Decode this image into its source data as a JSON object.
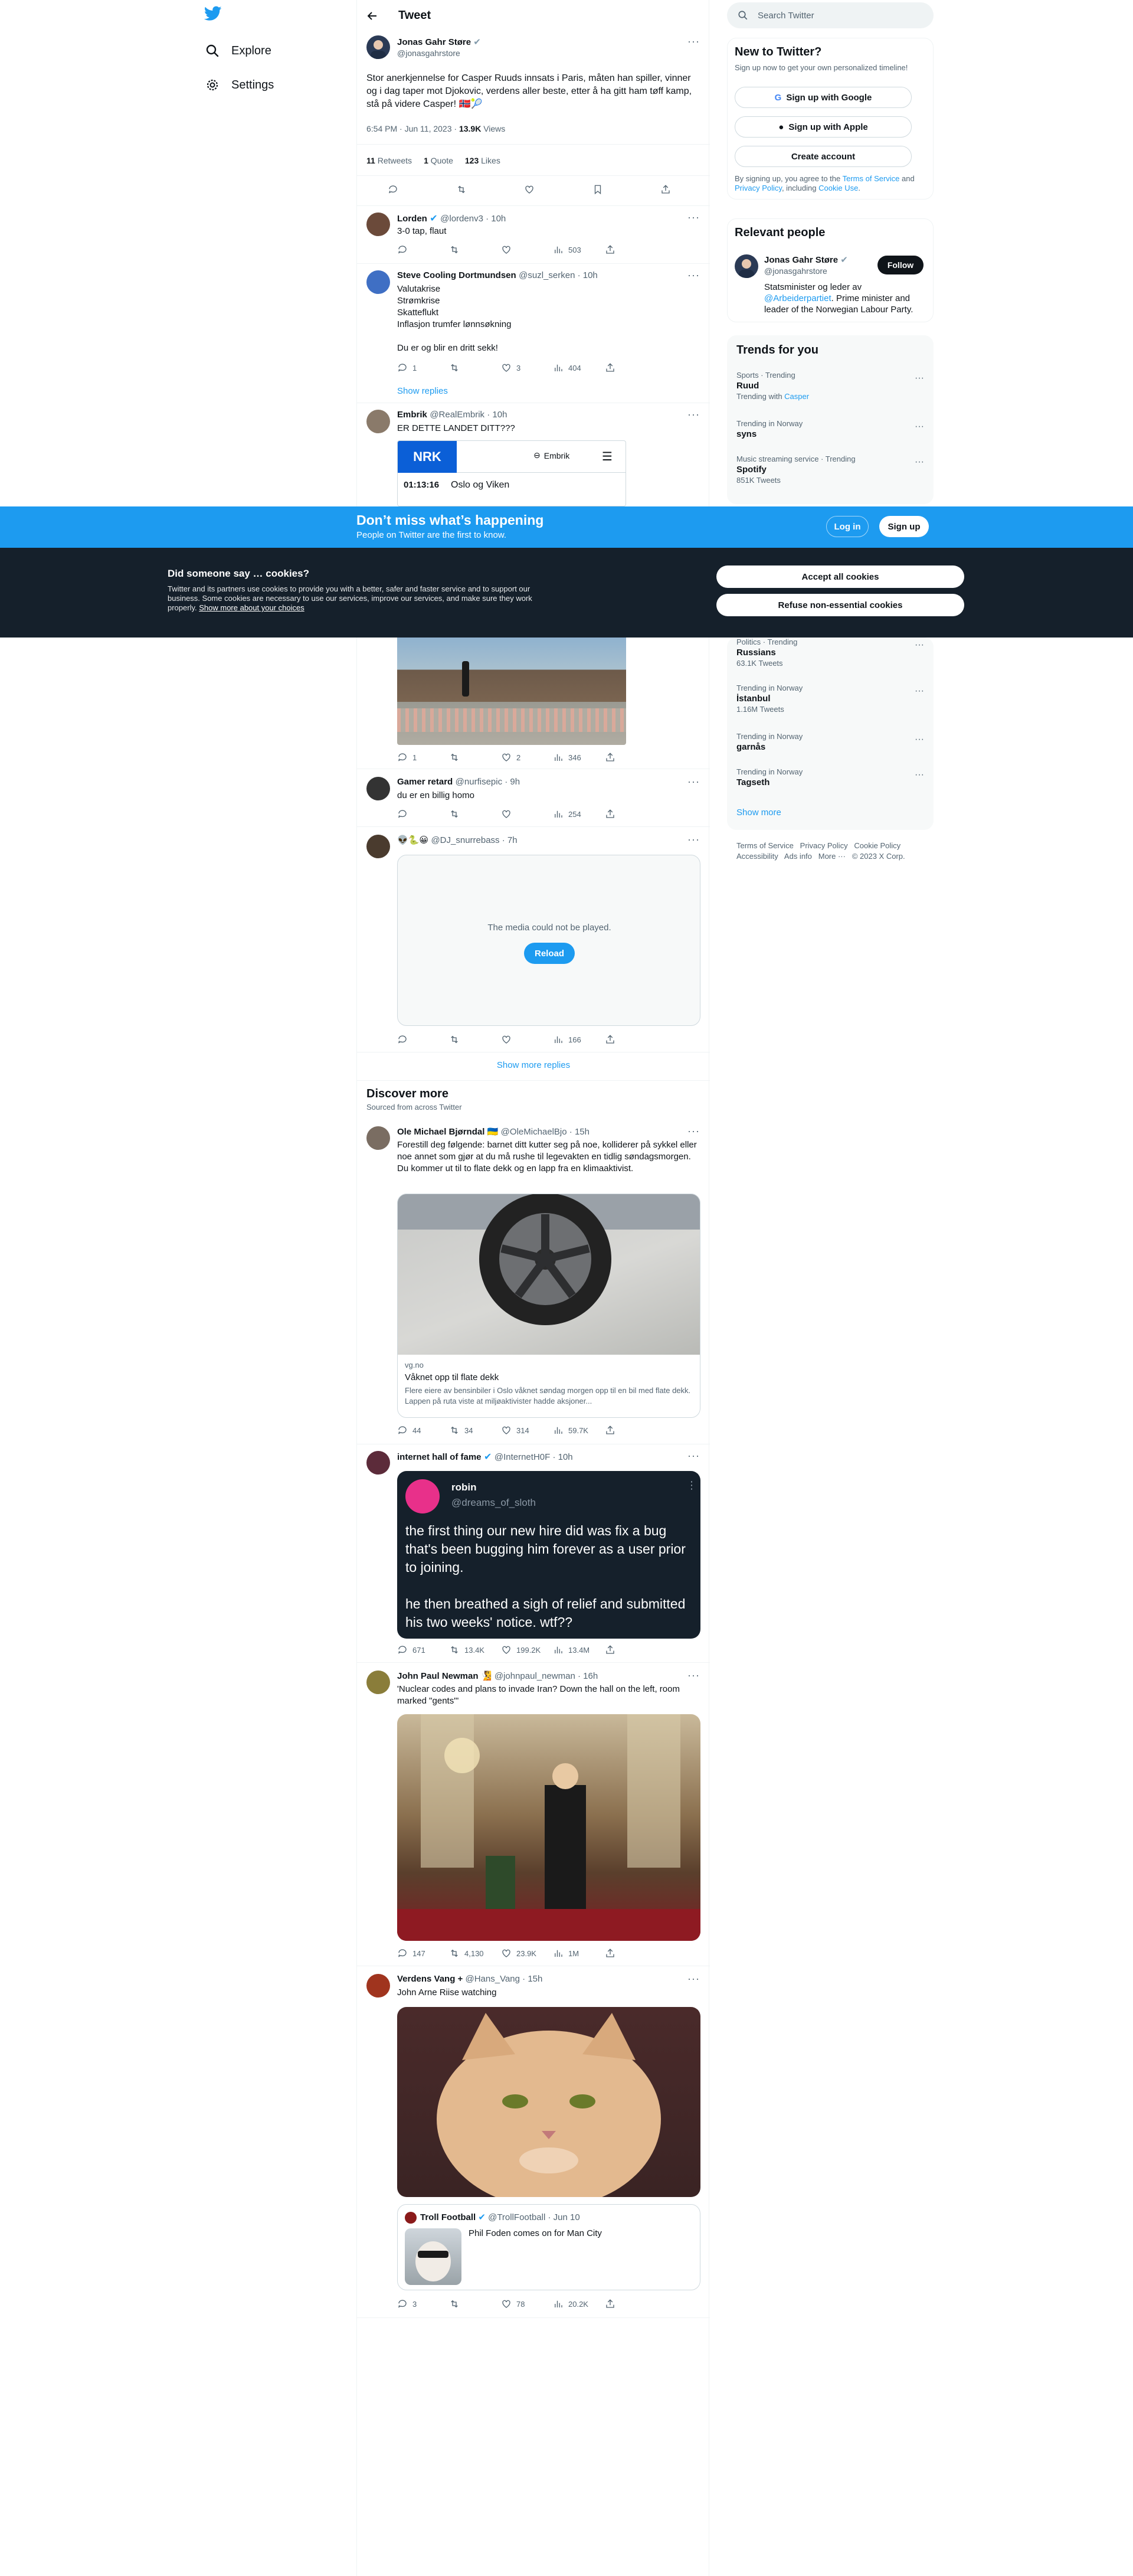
{
  "nav": {
    "explore": "Explore",
    "settings": "Settings"
  },
  "header": {
    "title": "Tweet"
  },
  "main_tweet": {
    "name": "Jonas Gahr Støre",
    "handle": "@jonasgahrstore",
    "text": "Stor anerkjennelse for Casper Ruuds innsats i Paris, måten han spiller, vinner og i dag taper mot Djokovic, verdens aller beste, etter å ha gitt ham tøff kamp, stå på videre Casper! 🇳🇴🎾",
    "time": "6:54 PM · Jun 11, 2023",
    "views_count": "13.9K",
    "views_label": "Views",
    "retweets_count": "11",
    "retweets_label": "Retweets",
    "quotes_count": "1",
    "quotes_label": "Quote",
    "likes_count": "123",
    "likes_label": "Likes"
  },
  "replies": [
    {
      "name": "Lorden",
      "handle": "@lordenv3 · 10h",
      "text": "3-0 tap, flaut",
      "replies": "",
      "retweets": "",
      "likes": "",
      "views": "503"
    },
    {
      "name": "Steve Cooling Dortmundsen",
      "handle": "@suzl_serken · 10h",
      "text": "Valutakrise\nStrømkrise\nSkatteflukt\nInflasjon trumfer lønnsøkning\n\nDu er og blir en dritt sekk!",
      "replies": "1",
      "retweets": "",
      "likes": "3",
      "views": "404",
      "show_replies": "Show replies"
    },
    {
      "name": "Embrik",
      "handle": "@RealEmbrik · 10h",
      "text": "ER DETTE LANDET DITT???",
      "replies": "1",
      "retweets": "",
      "likes": "2",
      "views": "346",
      "card_logo": "NRK",
      "card_user": "Embrik",
      "card_time": "01:13:16",
      "card_place": "Oslo og Viken"
    },
    {
      "name": "Gamer retard",
      "handle": "@nurfisepic · 9h",
      "text": "du er en billig homo",
      "replies": "",
      "retweets": "",
      "likes": "",
      "views": "254"
    },
    {
      "name": "👽🐍😀",
      "handle": "@DJ_snurrebass · 7h",
      "text": "",
      "media_error": "The media could not be played.",
      "reload": "Reload",
      "replies": "",
      "retweets": "",
      "likes": "",
      "views": "166"
    }
  ],
  "show_more_replies": "Show more replies",
  "discover": {
    "title": "Discover more",
    "subtitle": "Sourced from across Twitter",
    "tweets": [
      {
        "name": "Ole Michael Bjørndal 🇺🇦",
        "handle": "@OleMichaelBjo · 15h",
        "text": "Forestill deg følgende: barnet ditt kutter seg på noe, kolliderer på sykkel eller noe annet som gjør at du må rushe til legevakten en tidlig søndagsmorgen. Du kommer ut til to flate dekk og en lapp fra en klimaaktivist.",
        "link_domain": "vg.no",
        "link_title": "Våknet opp til flate dekk",
        "link_desc": "Flere eiere av bensinbiler i Oslo våknet søndag morgen opp til en bil med flate dekk. Lappen på ruta viste at miljøaktivister hadde aksjoner...",
        "replies": "44",
        "retweets": "34",
        "likes": "314",
        "views": "59.7K"
      },
      {
        "name": "internet hall of fame",
        "handle": "@InternetH0F · 10h",
        "quote_name": "robin",
        "quote_handle": "@dreams_of_sloth",
        "quote_text": "the first thing our new hire did was fix a bug that's been bugging him forever as a user prior to joining.\n\nhe then breathed a sigh of relief and submitted his two weeks' notice. wtf??",
        "replies": "671",
        "retweets": "13.4K",
        "likes": "199.2K",
        "views": "13.4M"
      },
      {
        "name": "John Paul Newman 🧏",
        "handle": "@johnpaul_newman · 16h",
        "text": "'Nuclear codes and plans to invade Iran? Down the hall on the left, room marked \"gents\"'",
        "replies": "147",
        "retweets": "4,130",
        "likes": "23.9K",
        "views": "1M"
      },
      {
        "name": "Verdens Vang + ",
        "handle": "@Hans_Vang · 15h",
        "text": "John Arne Riise watching",
        "quote_name": "Troll Football",
        "quote_handle": "@TrollFootball · Jun 10",
        "quote_text": "Phil Foden comes on for Man City",
        "replies": "3",
        "retweets": "",
        "likes": "78",
        "views": "20.2K"
      }
    ]
  },
  "right": {
    "search_placeholder": "Search Twitter",
    "new_title": "New to Twitter?",
    "new_sub": "Sign up now to get your own personalized timeline!",
    "google": "Sign up with Google",
    "apple": "Sign up with Apple",
    "create": "Create account",
    "terms_pre": "By signing up, you agree to the ",
    "terms_link": "Terms of Service",
    "terms_and": " and ",
    "privacy_link": "Privacy Policy",
    "terms_mid": ", including ",
    "cookie_link": "Cookie Use",
    "terms_end": ".",
    "relevant_title": "Relevant people",
    "person_name": "Jonas Gahr Støre",
    "person_handle": "@jonasgahrstore",
    "follow": "Follow",
    "bio_a": "Statsminister og leder av ",
    "bio_link": "@Arbeiderpartiet",
    "bio_b": ". Prime minister and leader of the Norwegian Labour Party.",
    "trends_title": "Trends for you",
    "trends_top": [
      {
        "cat": "Sports · Trending",
        "title": "Ruud",
        "sub_pre": "Trending with ",
        "sub_link": "Casper"
      },
      {
        "cat": "Trending in Norway",
        "title": "syns",
        "sub_pre": "",
        "sub_link": ""
      },
      {
        "cat": "Music streaming service · Trending",
        "title": "Spotify",
        "sub_pre": "851K Tweets",
        "sub_link": ""
      }
    ],
    "trends_bottom": [
      {
        "cat": "Politics · Trending",
        "title": "Russians",
        "sub": "63.1K Tweets"
      },
      {
        "cat": "Trending in Norway",
        "title": "İstanbul",
        "sub": "1.16M Tweets"
      },
      {
        "cat": "Trending in Norway",
        "title": "garnås",
        "sub": ""
      },
      {
        "cat": "Trending in Norway",
        "title": "Tagseth",
        "sub": ""
      }
    ],
    "show_more": "Show more",
    "footer": [
      "Terms of Service",
      "Privacy Policy",
      "Cookie Policy",
      "Accessibility",
      "Ads info",
      "More ···",
      "© 2023 X Corp."
    ]
  },
  "banner": {
    "title": "Don’t miss what’s happening",
    "sub": "People on Twitter are the first to know.",
    "login": "Log in",
    "signup": "Sign up"
  },
  "cookie": {
    "title": "Did someone say … cookies?",
    "text": "Twitter and its partners use cookies to provide you with a better, safer and faster service and to support our business. Some cookies are necessary to use our services, improve our services, and make sure they work properly. ",
    "link": "Show more about your choices",
    "accept": "Accept all cookies",
    "refuse": "Refuse non-essential cookies"
  },
  "colors": {
    "accent": "#1d9bf0",
    "cookie_bg": "#15202b",
    "text": "#0f1419",
    "muted": "#536471"
  }
}
